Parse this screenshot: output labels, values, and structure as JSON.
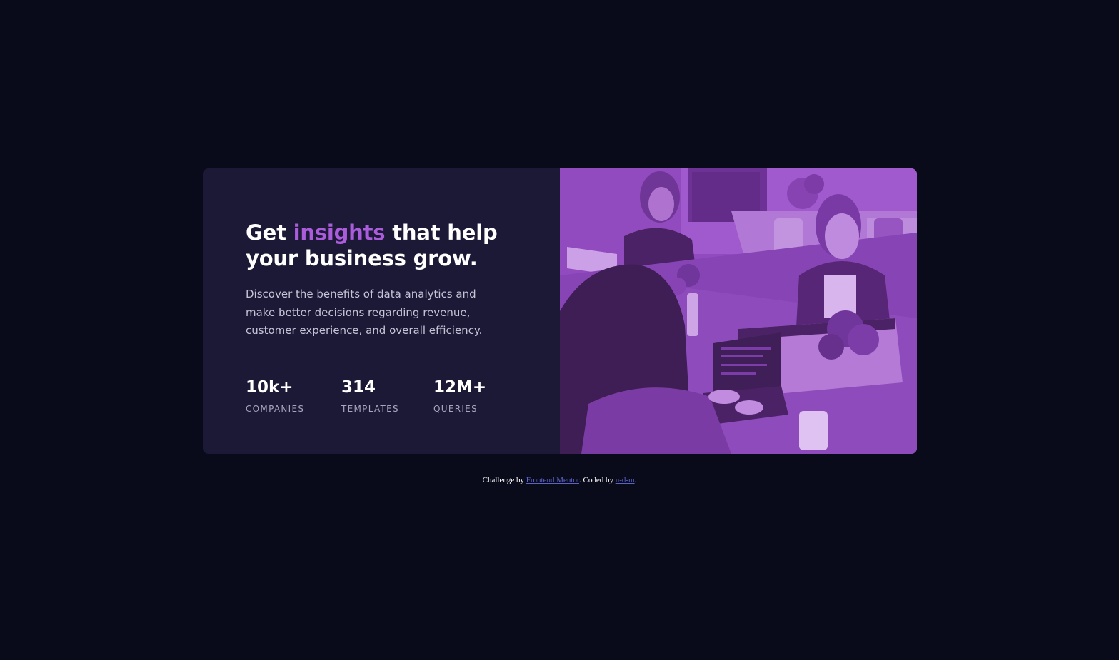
{
  "hero": {
    "title_part1": "Get ",
    "title_accent": "insights",
    "title_part2": " that help your business grow.",
    "description": "Discover the benefits of data analytics and make better decisions regarding revenue, customer experience, and overall efficiency."
  },
  "stats": [
    {
      "value": "10k+",
      "label": "COMPANIES"
    },
    {
      "value": "314",
      "label": "TEMPLATES"
    },
    {
      "value": "12M+",
      "label": "QUERIES"
    }
  ],
  "image": {
    "description_icon": "office-workers-photo"
  },
  "footer": {
    "prefix": "Challenge by ",
    "link1": "Frontend Mentor",
    "middle": ". Coded by ",
    "link2": "n-d-m",
    "suffix": "."
  },
  "colors": {
    "background": "#0a0b1a",
    "card": "#1b1936",
    "accent": "#ab5cdb",
    "image_tint": "#8b47b7",
    "link": "#5b62c8"
  }
}
